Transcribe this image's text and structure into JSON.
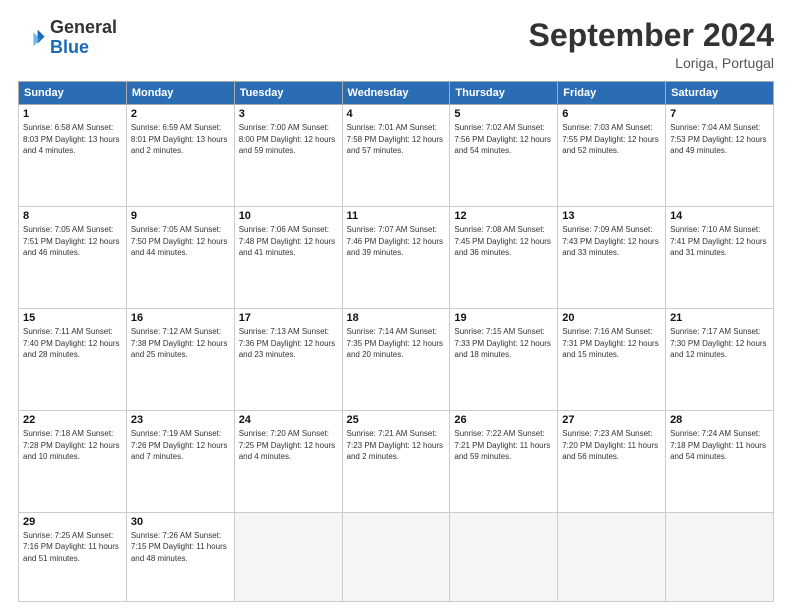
{
  "header": {
    "logo_general": "General",
    "logo_blue": "Blue",
    "month_title": "September 2024",
    "location": "Loriga, Portugal"
  },
  "days_of_week": [
    "Sunday",
    "Monday",
    "Tuesday",
    "Wednesday",
    "Thursday",
    "Friday",
    "Saturday"
  ],
  "weeks": [
    [
      {
        "day": "1",
        "info": "Sunrise: 6:58 AM\nSunset: 8:03 PM\nDaylight: 13 hours\nand 4 minutes."
      },
      {
        "day": "2",
        "info": "Sunrise: 6:59 AM\nSunset: 8:01 PM\nDaylight: 13 hours\nand 2 minutes."
      },
      {
        "day": "3",
        "info": "Sunrise: 7:00 AM\nSunset: 8:00 PM\nDaylight: 12 hours\nand 59 minutes."
      },
      {
        "day": "4",
        "info": "Sunrise: 7:01 AM\nSunset: 7:58 PM\nDaylight: 12 hours\nand 57 minutes."
      },
      {
        "day": "5",
        "info": "Sunrise: 7:02 AM\nSunset: 7:56 PM\nDaylight: 12 hours\nand 54 minutes."
      },
      {
        "day": "6",
        "info": "Sunrise: 7:03 AM\nSunset: 7:55 PM\nDaylight: 12 hours\nand 52 minutes."
      },
      {
        "day": "7",
        "info": "Sunrise: 7:04 AM\nSunset: 7:53 PM\nDaylight: 12 hours\nand 49 minutes."
      }
    ],
    [
      {
        "day": "8",
        "info": "Sunrise: 7:05 AM\nSunset: 7:51 PM\nDaylight: 12 hours\nand 46 minutes."
      },
      {
        "day": "9",
        "info": "Sunrise: 7:05 AM\nSunset: 7:50 PM\nDaylight: 12 hours\nand 44 minutes."
      },
      {
        "day": "10",
        "info": "Sunrise: 7:06 AM\nSunset: 7:48 PM\nDaylight: 12 hours\nand 41 minutes."
      },
      {
        "day": "11",
        "info": "Sunrise: 7:07 AM\nSunset: 7:46 PM\nDaylight: 12 hours\nand 39 minutes."
      },
      {
        "day": "12",
        "info": "Sunrise: 7:08 AM\nSunset: 7:45 PM\nDaylight: 12 hours\nand 36 minutes."
      },
      {
        "day": "13",
        "info": "Sunrise: 7:09 AM\nSunset: 7:43 PM\nDaylight: 12 hours\nand 33 minutes."
      },
      {
        "day": "14",
        "info": "Sunrise: 7:10 AM\nSunset: 7:41 PM\nDaylight: 12 hours\nand 31 minutes."
      }
    ],
    [
      {
        "day": "15",
        "info": "Sunrise: 7:11 AM\nSunset: 7:40 PM\nDaylight: 12 hours\nand 28 minutes."
      },
      {
        "day": "16",
        "info": "Sunrise: 7:12 AM\nSunset: 7:38 PM\nDaylight: 12 hours\nand 25 minutes."
      },
      {
        "day": "17",
        "info": "Sunrise: 7:13 AM\nSunset: 7:36 PM\nDaylight: 12 hours\nand 23 minutes."
      },
      {
        "day": "18",
        "info": "Sunrise: 7:14 AM\nSunset: 7:35 PM\nDaylight: 12 hours\nand 20 minutes."
      },
      {
        "day": "19",
        "info": "Sunrise: 7:15 AM\nSunset: 7:33 PM\nDaylight: 12 hours\nand 18 minutes."
      },
      {
        "day": "20",
        "info": "Sunrise: 7:16 AM\nSunset: 7:31 PM\nDaylight: 12 hours\nand 15 minutes."
      },
      {
        "day": "21",
        "info": "Sunrise: 7:17 AM\nSunset: 7:30 PM\nDaylight: 12 hours\nand 12 minutes."
      }
    ],
    [
      {
        "day": "22",
        "info": "Sunrise: 7:18 AM\nSunset: 7:28 PM\nDaylight: 12 hours\nand 10 minutes."
      },
      {
        "day": "23",
        "info": "Sunrise: 7:19 AM\nSunset: 7:26 PM\nDaylight: 12 hours\nand 7 minutes."
      },
      {
        "day": "24",
        "info": "Sunrise: 7:20 AM\nSunset: 7:25 PM\nDaylight: 12 hours\nand 4 minutes."
      },
      {
        "day": "25",
        "info": "Sunrise: 7:21 AM\nSunset: 7:23 PM\nDaylight: 12 hours\nand 2 minutes."
      },
      {
        "day": "26",
        "info": "Sunrise: 7:22 AM\nSunset: 7:21 PM\nDaylight: 11 hours\nand 59 minutes."
      },
      {
        "day": "27",
        "info": "Sunrise: 7:23 AM\nSunset: 7:20 PM\nDaylight: 11 hours\nand 56 minutes."
      },
      {
        "day": "28",
        "info": "Sunrise: 7:24 AM\nSunset: 7:18 PM\nDaylight: 11 hours\nand 54 minutes."
      }
    ],
    [
      {
        "day": "29",
        "info": "Sunrise: 7:25 AM\nSunset: 7:16 PM\nDaylight: 11 hours\nand 51 minutes."
      },
      {
        "day": "30",
        "info": "Sunrise: 7:26 AM\nSunset: 7:15 PM\nDaylight: 11 hours\nand 48 minutes."
      },
      {
        "day": "",
        "info": ""
      },
      {
        "day": "",
        "info": ""
      },
      {
        "day": "",
        "info": ""
      },
      {
        "day": "",
        "info": ""
      },
      {
        "day": "",
        "info": ""
      }
    ]
  ]
}
